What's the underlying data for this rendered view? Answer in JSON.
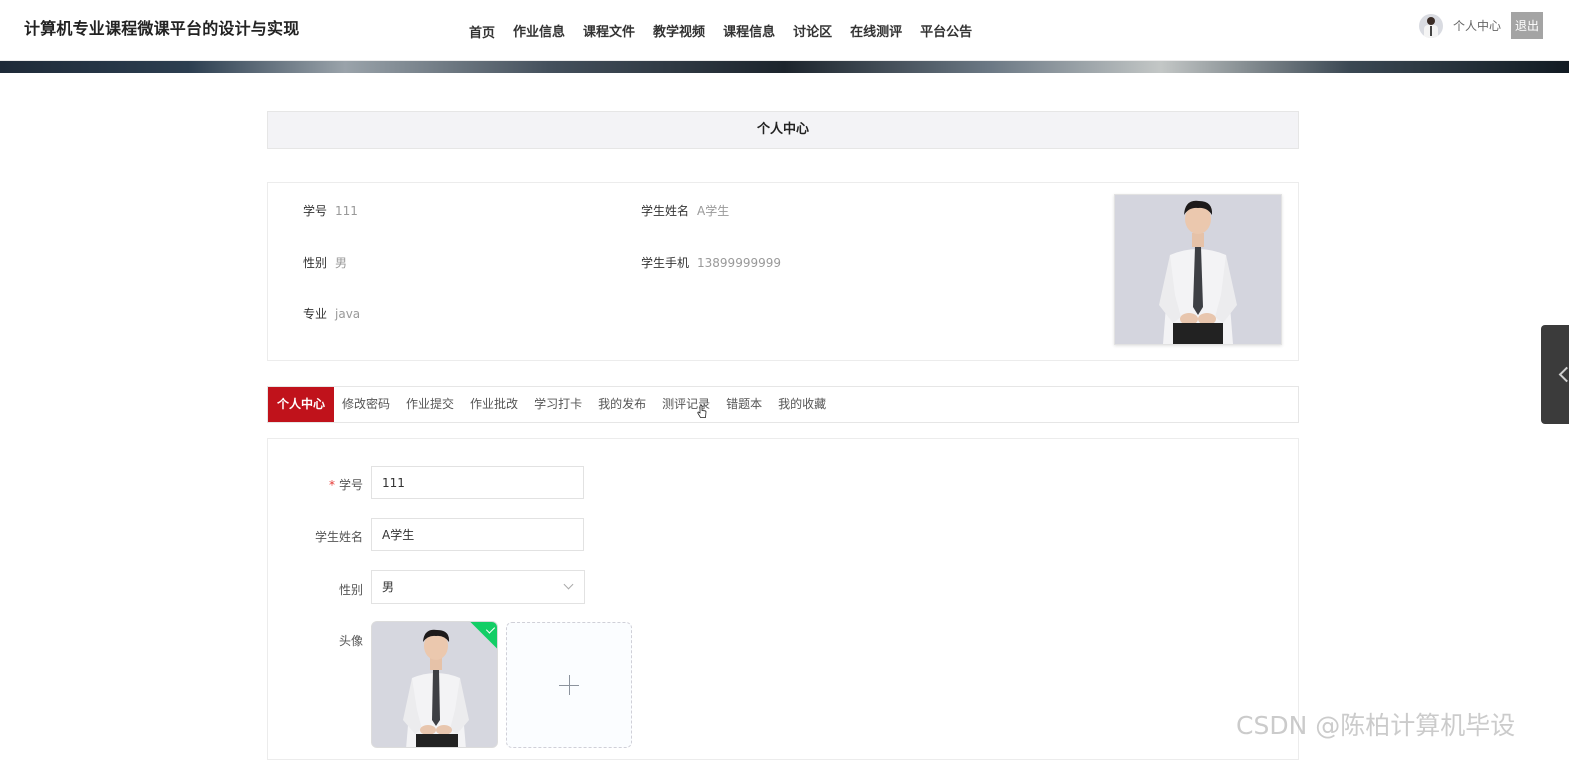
{
  "header": {
    "site_title": "计算机专业课程微课平台的设计与实现",
    "nav": [
      "首页",
      "作业信息",
      "课程文件",
      "教学视频",
      "课程信息",
      "讨论区",
      "在线测评",
      "平台公告"
    ],
    "user_center": "个人中心",
    "logout": "退出"
  },
  "section_title": "个人中心",
  "profile": {
    "student_id_label": "学号",
    "student_id": "111",
    "name_label": "学生姓名",
    "name": "A学生",
    "gender_label": "性别",
    "gender": "男",
    "phone_label": "学生手机",
    "phone": "13899999999",
    "major_label": "专业",
    "major": "java"
  },
  "tabs": [
    "个人中心",
    "修改密码",
    "作业提交",
    "作业批改",
    "学习打卡",
    "我的发布",
    "测评记录",
    "错题本",
    "我的收藏"
  ],
  "active_tab": "个人中心",
  "form": {
    "required_mark": "*",
    "student_id_label": "学号",
    "student_id_value": "111",
    "name_label": "学生姓名",
    "name_value": "A学生",
    "gender_label": "性别",
    "gender_value": "男",
    "avatar_label": "头像"
  },
  "icons": {
    "avatar": "user-avatar",
    "dropdown": "chevron-down-icon",
    "upload_success": "check-icon",
    "upload_add": "plus-icon",
    "side_toggle": "chevron-left-icon"
  },
  "colors": {
    "active_tab": "#c0121b",
    "logout_button": "#a4a4a4",
    "upload_success": "#13ce66"
  },
  "watermark": "CSDN @陈柏计算机毕设"
}
